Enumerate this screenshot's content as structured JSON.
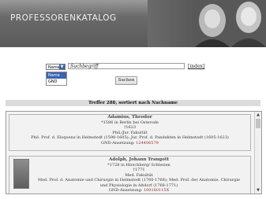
{
  "header": {
    "title": "PROFESSORENKATALOG"
  },
  "search": {
    "mode_selected": "Name",
    "mode_options": [
      "Name",
      "GND"
    ],
    "placeholder": "Suchbegriff",
    "index_link": "[index]",
    "submit_label": "Suchen"
  },
  "results": {
    "summary": "Treffer 288, sortiert nach Nachname",
    "entries": [
      {
        "name": "Adamius, Theodor",
        "line1": "*1586 in Berlin bei Osterode",
        "line2": "†1623",
        "line3": "Phil./Jur. Fakultät",
        "line4": "Phil. Prof. d. Eloquenz in Helmstedt (1598-1605); Jur. Prof. d. Pandekten in Helmstedt (1605-1623)",
        "gnd_label": "GND-Ansetzung:",
        "gnd_value": "124406579"
      },
      {
        "name": "Adolph, Johann Traugott",
        "line1": "*1728 in Hirschberg/ Schlesien",
        "line2": "†1771",
        "line3": "Med. Fakultät",
        "line4": "Med. Prof. d. Anatomie und Chirurgie in Helmstedt (1760-1768); Med. Prof. der Anatomie, Chirurgie",
        "line5": "und Physiologie in Altdorf (1768-1771)",
        "gnd_label": "GND-Ansetzung:",
        "gnd_value": "100160115X"
      }
    ]
  },
  "colors": {
    "accent": "#3a63b0",
    "gnd_link": "#8a2a2a"
  }
}
